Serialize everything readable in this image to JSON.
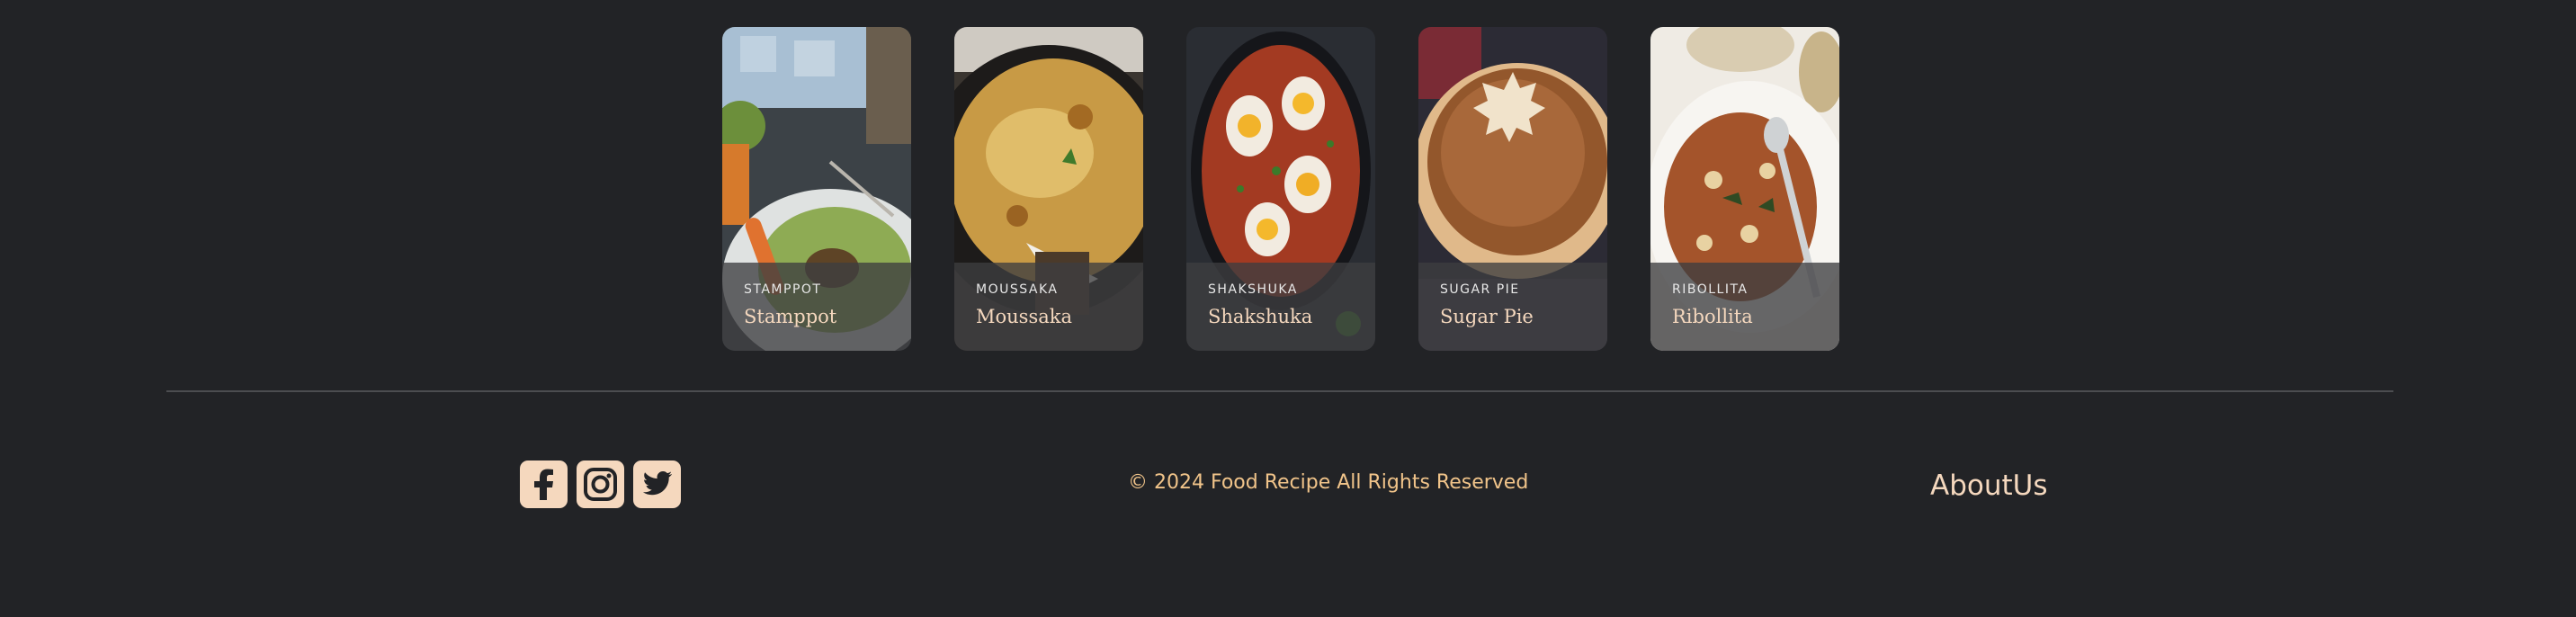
{
  "recipes": [
    {
      "category": "STAMPPOT",
      "title": "Stamppot"
    },
    {
      "category": "MOUSSAKA",
      "title": "Moussaka"
    },
    {
      "category": "SHAKSHUKA",
      "title": "Shakshuka"
    },
    {
      "category": "SUGAR PIE",
      "title": "Sugar Pie"
    },
    {
      "category": "RIBOLLITA",
      "title": "Ribollita"
    }
  ],
  "footer": {
    "social_icons": [
      "facebook-icon",
      "instagram-icon",
      "twitter-icon"
    ],
    "copyright": "© 2024 Food Recipe All Rights Reserved",
    "about_link": "AboutUs"
  },
  "colors": {
    "background": "#222326",
    "accent": "#f5d8be",
    "copyright_text": "#f1c48a",
    "divider": "#4c4d50"
  }
}
